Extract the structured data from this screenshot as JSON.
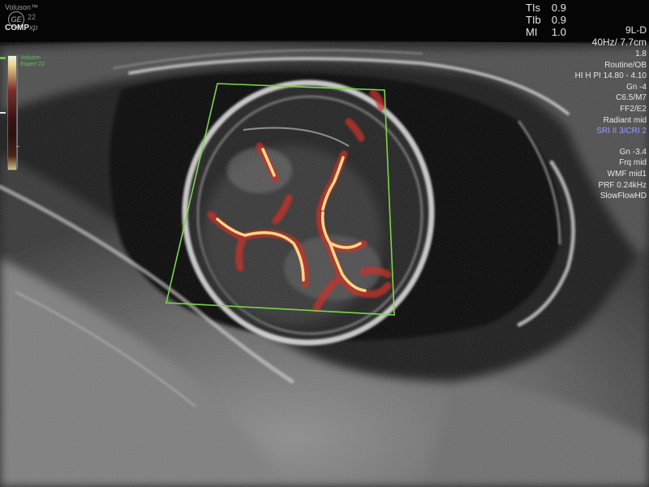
{
  "header": {
    "brand_name": "Voluson™",
    "brand_model": "22",
    "brand_mode": "COMP",
    "brand_mode_suffix": "xp",
    "logo_text": "GE",
    "safety_indices": [
      {
        "label": "TIs",
        "value": "0.9"
      },
      {
        "label": "TIb",
        "value": "0.9"
      },
      {
        "label": "MI",
        "value": "1.0"
      }
    ]
  },
  "params": {
    "probe": "9L-D",
    "frame_depth": "40Hz/ 7.7cm",
    "zoom": "1.8",
    "preset": "Routine/OB",
    "harmonics": "HI H PI 14.80 - 4.10",
    "gain": "Gn -4",
    "contrast": "C6.5/M7",
    "focus": "FF2/E2",
    "radiant": "Radiant mid",
    "sri_cri": "SRI II 3/CRI 2",
    "color_gain": "Gn -3.4",
    "frequency": "Frq mid",
    "wall_filter": "WMF mid1",
    "prf": "PRF 0.24kHz",
    "flow_mode": "SlowFlowHD"
  },
  "colormap": {
    "brand_line1": "Voluson",
    "brand_line2": "Expert 22",
    "accent_color": "#5fbf5f"
  },
  "roi": {
    "color": "#7ed44a"
  },
  "colors": {
    "background": "#000000",
    "text": "#e6e6e6",
    "sri_accent": "#9c9cff",
    "flow_core": "#ffe08a",
    "flow_edge": "#c8322a"
  }
}
